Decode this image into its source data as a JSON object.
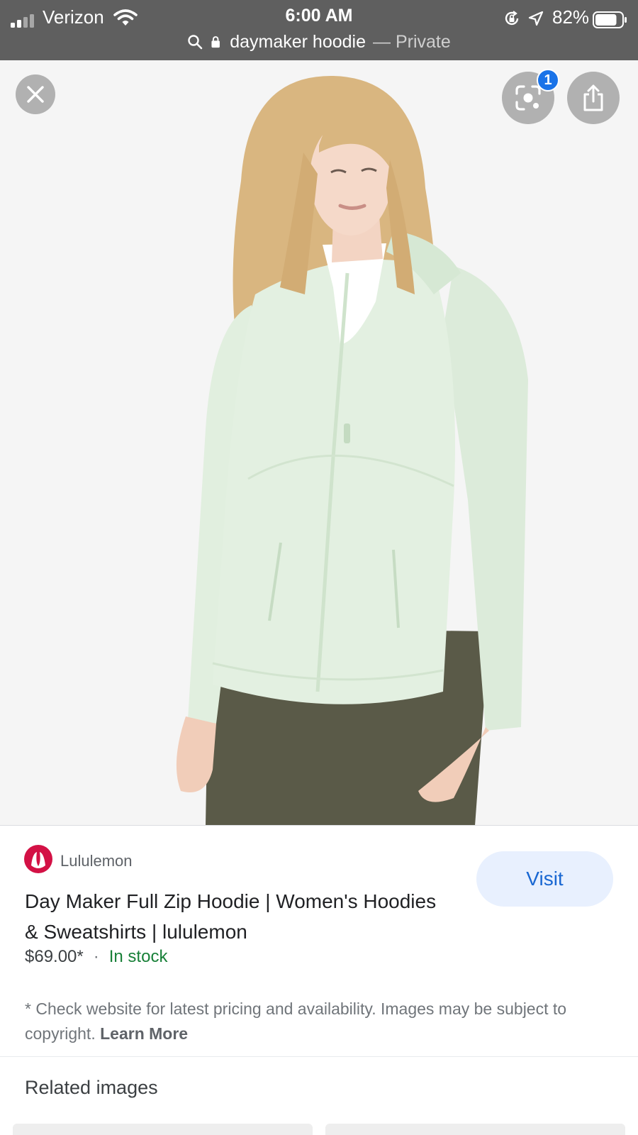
{
  "status_bar": {
    "carrier": "Verizon",
    "time": "6:00 AM",
    "battery": "82%",
    "battery_level": 0.82
  },
  "url_bar": {
    "query": "daymaker hoodie",
    "mode": "— Private"
  },
  "viewer": {
    "lens_badge": "1",
    "icons": [
      "close-icon",
      "lens-icon",
      "share-icon"
    ]
  },
  "product": {
    "source": "Lululemon",
    "title": "Day Maker Full Zip Hoodie | Women's Hoodies & Sweatshirts | lululemon",
    "price": "$69.00*",
    "separator": "·",
    "availability": "In stock",
    "visit_label": "Visit",
    "disclaimer": "* Check website for latest pricing and availability. Images may be subject to copyright.",
    "learn_more": "Learn More"
  },
  "related": {
    "heading": "Related images"
  },
  "colors": {
    "accent": "#1967d2",
    "visit_bg": "#e8f0fe",
    "stock_green": "#188038",
    "brand_red": "#d31145",
    "jacket": "#e3f0e1",
    "pants": "#5a5a48"
  }
}
